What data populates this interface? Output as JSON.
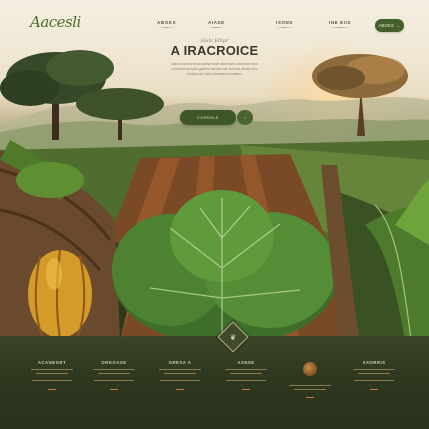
{
  "brand": {
    "logo_text": "Aacesli"
  },
  "nav": {
    "items": [
      "ABOKS",
      "AIASE",
      "ISONS",
      "INE EIIS"
    ],
    "cta_label": "ABOKS",
    "cta_icon": "arrow-right-icon"
  },
  "hero": {
    "subtitle": "Slalc Elhpr",
    "title": "A IRACROICE",
    "description": "Liaeu ousecna ornai ruaesce issei aiouneqnuo alameae recor onnncecit anrayola gaarirm nanusa onie lomerae acuspe nen nerepnnum oteai cnniraanse euuaamo",
    "primary_button": "CORKELE",
    "secondary_button_icon": "arrow-right-icon"
  },
  "footer": {
    "badge_icon": "leaf-emblem-icon",
    "features": [
      {
        "title": "ACANEGRT"
      },
      {
        "title": "ORKOASE"
      },
      {
        "title": "ORESA A"
      },
      {
        "title": "ASNSE"
      },
      {
        "title": "",
        "icon": "seed-cluster-icon"
      },
      {
        "title": "ASORRIS"
      }
    ]
  },
  "colors": {
    "accent_green": "#445f27",
    "footer_bg": "#2f3a20",
    "footer_text": "#d6cda7",
    "accent_orange": "#c27a3a"
  }
}
